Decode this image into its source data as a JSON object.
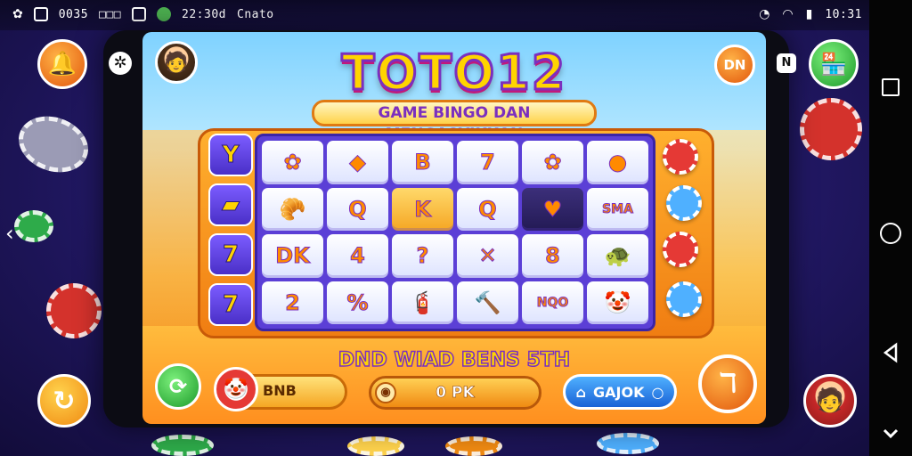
{
  "status_bar": {
    "items_left": [
      "0035",
      "□□□",
      "22:30d",
      "Cnato"
    ],
    "time": "10:31"
  },
  "game": {
    "title": "TOTO12",
    "subtitle": "GAME BINGO DAN MENGASYIKKAN",
    "banner": "DND WIAD BENS 5TH",
    "side_tiles": [
      "Y",
      "▰",
      "7",
      "7"
    ],
    "board": [
      [
        "✿",
        "◆",
        "B",
        "7",
        "✿",
        "●"
      ],
      [
        "🥐",
        "Q",
        "K",
        "Q",
        "♥",
        "SMA"
      ],
      [
        "DK",
        "4",
        "?",
        "✕",
        "8",
        "🐢"
      ],
      [
        "2",
        "%",
        "🧯",
        "🔨",
        "NQO",
        "🤡"
      ]
    ],
    "coin_value": "BNB",
    "center_value": "0 PK",
    "blue_button": "GAJOK",
    "orange_button": "ℸ",
    "top_right_button": "DN",
    "small_badge": "N"
  },
  "colors": {
    "accent_orange": "#f08a12",
    "accent_purple": "#7b2fbf",
    "accent_green": "#1d9a2a",
    "accent_blue": "#1a62d6",
    "title_yellow": "#ffd400"
  }
}
